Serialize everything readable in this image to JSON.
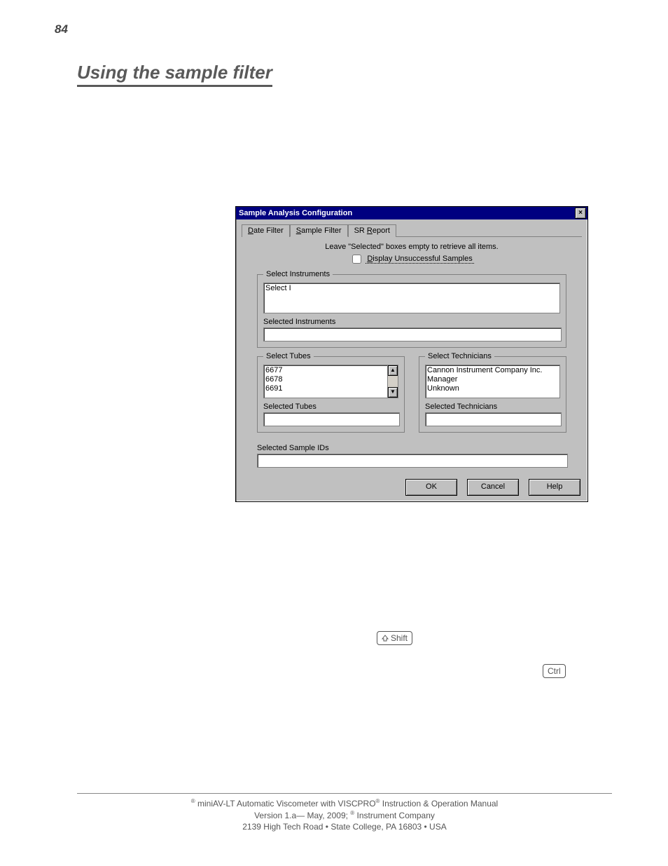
{
  "page_number": "84",
  "heading": "Using the sample filter",
  "dialog": {
    "title": "Sample Analysis Configuration",
    "close_glyph": "×",
    "tabs": {
      "date_filter": "Date Filter",
      "sample_filter": "Sample Filter",
      "sr_report": "SR Report"
    },
    "hint": "Leave \"Selected\" boxes empty to retrieve all items.",
    "checkbox_label_prefix": "D",
    "checkbox_label_rest": "isplay Unsuccessful Samples",
    "select_instruments_legend": "Select Instruments",
    "instruments_item": "Select I",
    "selected_instruments_label": "Selected Instruments",
    "select_tubes_legend": "Select Tubes",
    "tubes": {
      "a": "6677",
      "b": "6678",
      "c": "6691"
    },
    "selected_tubes_label": "Selected Tubes",
    "select_technicians_legend": "Select Technicians",
    "technicians": {
      "a": "Cannon Instrument Company Inc.",
      "b": "Manager",
      "c": "Unknown"
    },
    "selected_technicians_label": "Selected Technicians",
    "selected_sample_ids_label": "Selected Sample IDs",
    "buttons": {
      "ok": "OK",
      "cancel": "Cancel",
      "help": "Help"
    },
    "scroll_up": "▲",
    "scroll_down": "▼"
  },
  "keys": {
    "shift": "Shift",
    "ctrl": "Ctrl"
  },
  "footer": {
    "line1_pre": " miniAV-LT Automatic Viscometer with VISCPRO",
    "line1_post": " Instruction & Operation Manual",
    "line2_pre": "Version 1.a— May, 2009; ",
    "line2_post": " Instrument Company",
    "line3": "2139 High Tech Road • State College, PA  16803 • USA",
    "reg": "®"
  }
}
